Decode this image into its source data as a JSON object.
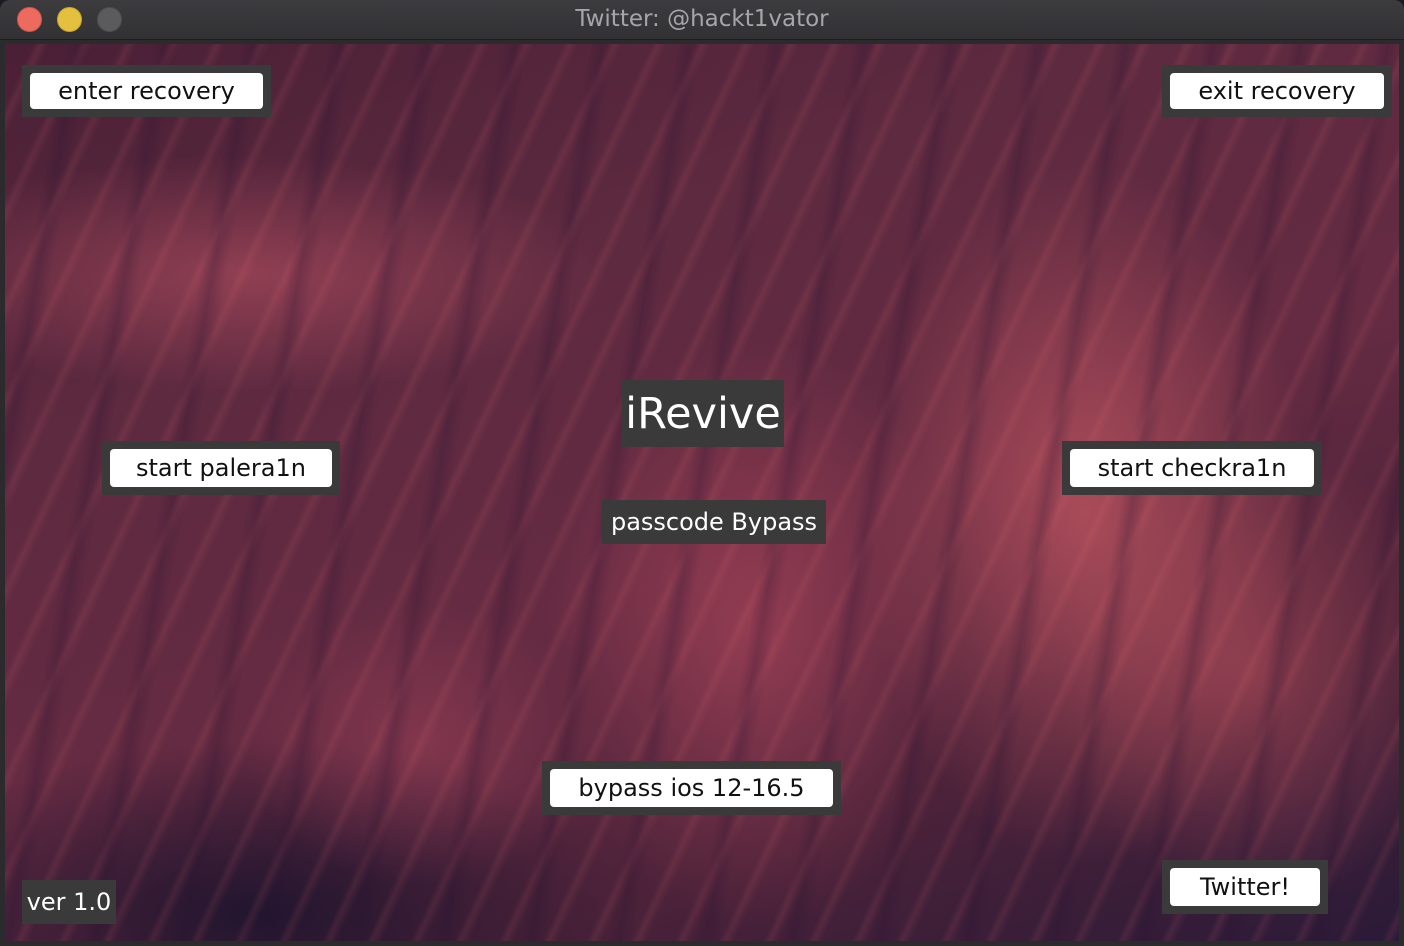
{
  "window": {
    "title": "Twitter: @hackt1vator"
  },
  "app": {
    "name": "iRevive",
    "subtitle": "passcode Bypass",
    "version": "ver 1.0"
  },
  "buttons": {
    "enter_recovery": "enter recovery",
    "exit_recovery": "exit recovery",
    "start_palera1n": "start palera1n",
    "start_checkra1n": "start checkra1n",
    "bypass": "bypass ios 12-16.5",
    "twitter": "Twitter!"
  },
  "colors": {
    "button_bg": "#ffffff",
    "frame": "#3a3a3a",
    "close": "#ed6a5e",
    "minimize": "#e3c03e",
    "zoom_disabled": "#5b5b5e"
  },
  "icons": [
    "close-window-icon",
    "minimize-window-icon",
    "zoom-window-icon"
  ]
}
